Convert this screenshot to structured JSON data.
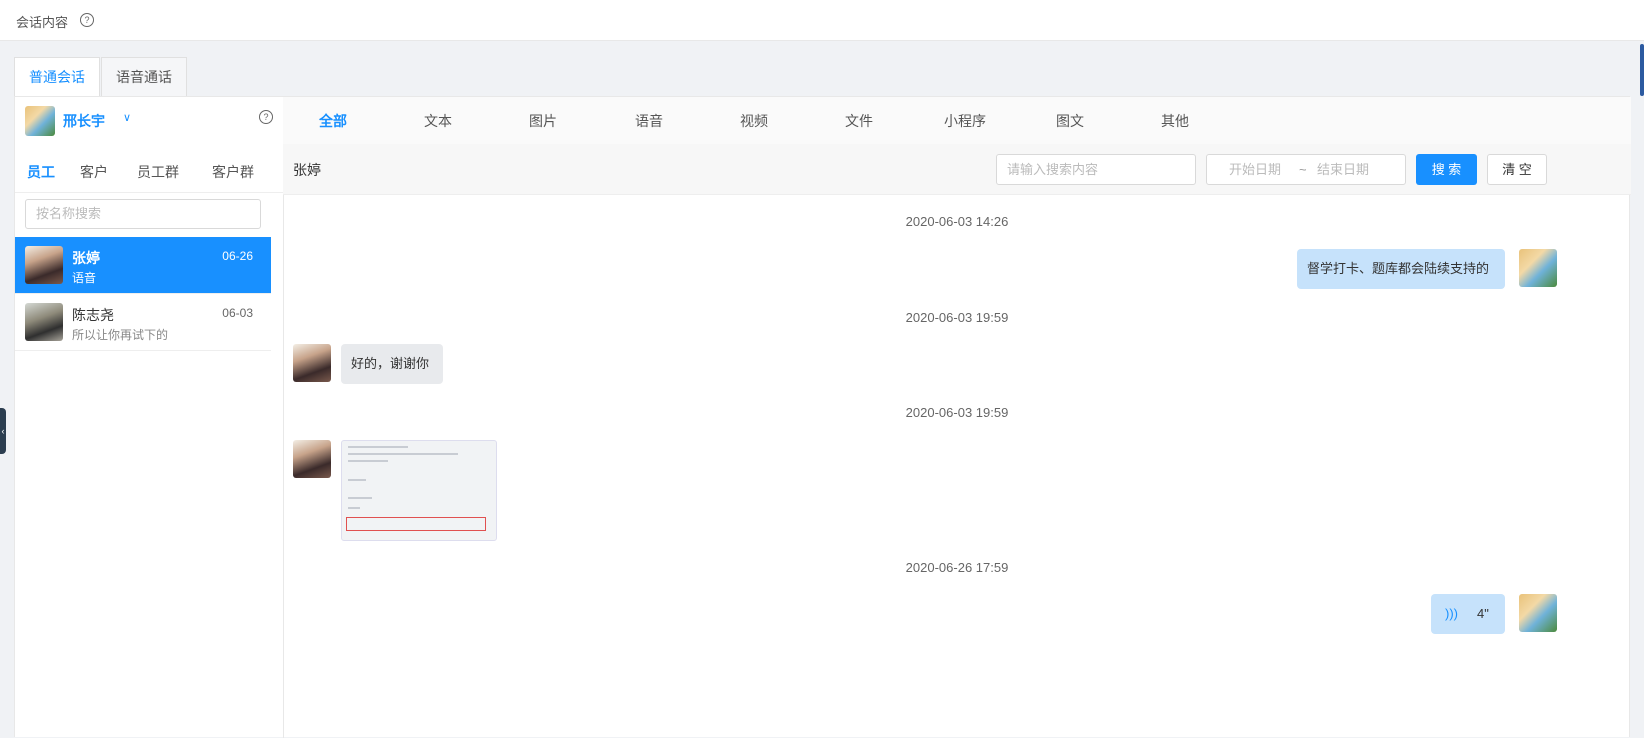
{
  "topbar": {
    "title": "会话内容",
    "help_icon": "?"
  },
  "tabs": [
    {
      "label": "普通会话",
      "active": true
    },
    {
      "label": "语音通话",
      "active": false
    }
  ],
  "current_user": {
    "name": "邢长宇",
    "caret": "∨",
    "help_icon": "?"
  },
  "subtabs": [
    {
      "label": "员工",
      "active": true
    },
    {
      "label": "客户",
      "active": false
    },
    {
      "label": "员工群",
      "active": false
    },
    {
      "label": "客户群",
      "active": false
    }
  ],
  "name_search": {
    "placeholder": "按名称搜索"
  },
  "contacts": [
    {
      "name": "张婷",
      "date": "06-26",
      "last_msg": "语音",
      "active": true
    },
    {
      "name": "陈志尧",
      "date": "06-03",
      "last_msg": "所以让你再试下的",
      "active": false
    }
  ],
  "filter_tabs": [
    {
      "label": "全部",
      "active": true
    },
    {
      "label": "文本"
    },
    {
      "label": "图片"
    },
    {
      "label": "语音"
    },
    {
      "label": "视频"
    },
    {
      "label": "文件"
    },
    {
      "label": "小程序"
    },
    {
      "label": "图文"
    },
    {
      "label": "其他"
    }
  ],
  "chat": {
    "contact_name": "张婷",
    "search_placeholder": "请输入搜索内容",
    "date_start_placeholder": "开始日期",
    "date_sep": "~",
    "date_end_placeholder": "结束日期",
    "search_button": "搜 索",
    "clear_button": "清 空"
  },
  "messages": [
    {
      "time": "2020-06-03 14:26",
      "from": "me",
      "type": "text",
      "text": "督学打卡、题库都会陆续支持的"
    },
    {
      "time": "2020-06-03 19:59",
      "from": "other",
      "type": "text",
      "text": "好的，谢谢你"
    },
    {
      "time": "2020-06-03 19:59",
      "from": "other",
      "type": "image"
    },
    {
      "time": "2020-06-26 17:59",
      "from": "me",
      "type": "voice",
      "duration": "4\""
    }
  ],
  "colors": {
    "accent": "#1890ff",
    "my_bubble": "#c6e2fb",
    "other_bubble": "#e8eaed"
  }
}
